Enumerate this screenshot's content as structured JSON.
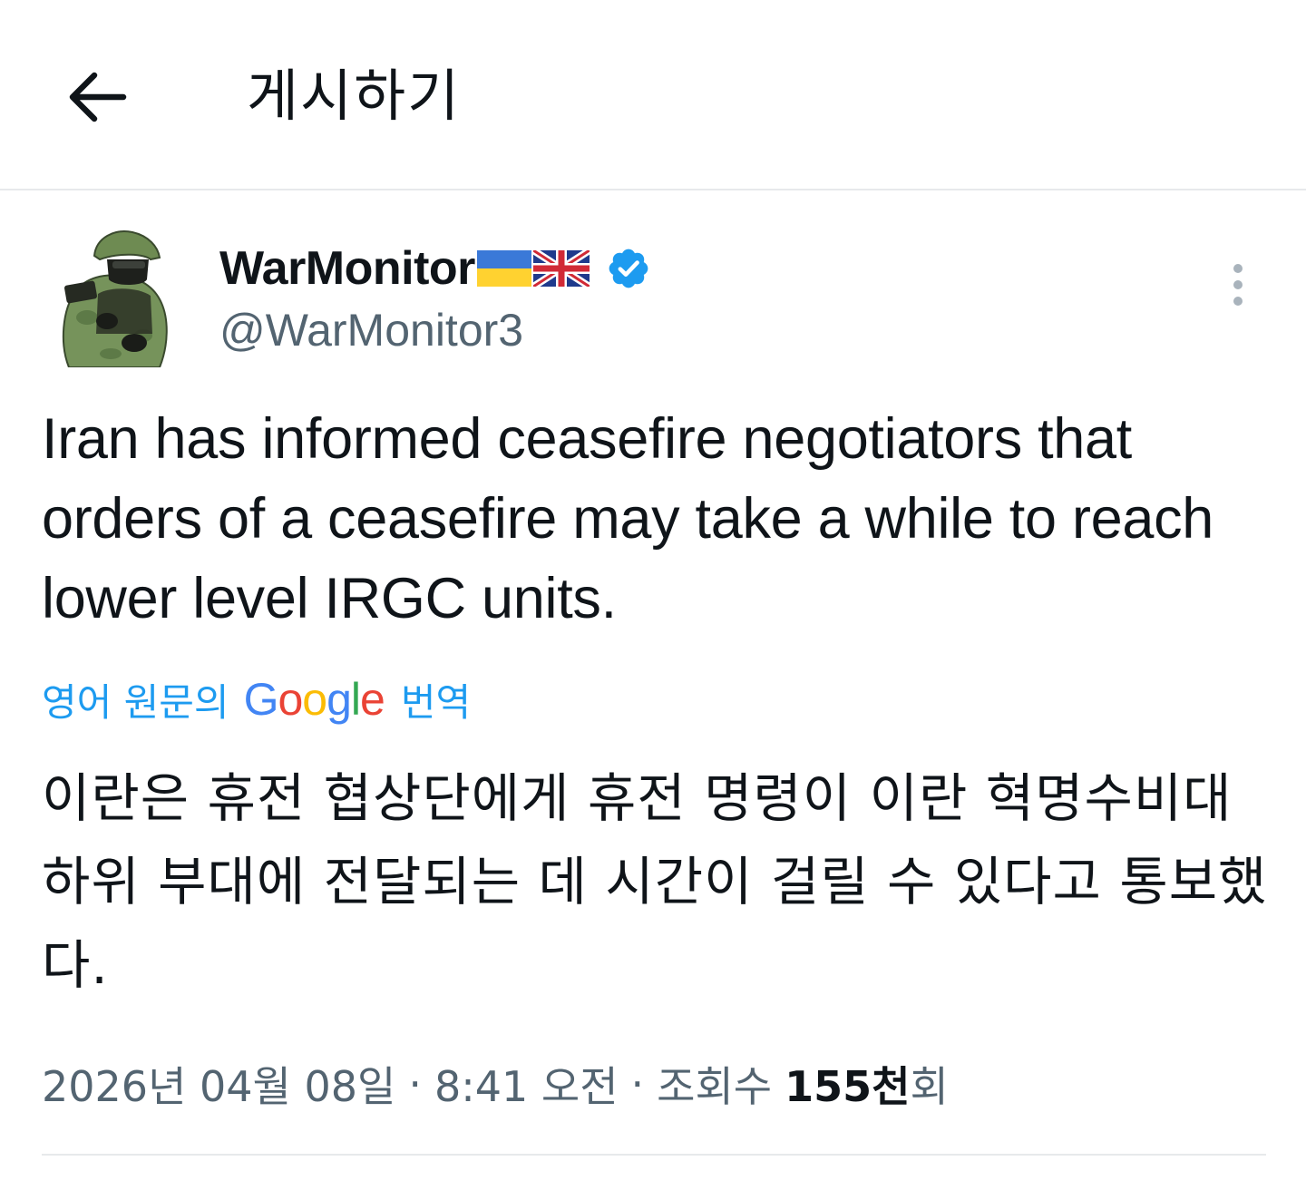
{
  "header": {
    "title": "게시하기",
    "back_icon": "arrow-left-icon"
  },
  "author": {
    "display_name": "WarMonitor",
    "flags": [
      "ukraine-flag-icon",
      "uk-flag-icon"
    ],
    "verified_icon": "verified-badge-icon",
    "handle": "@WarMonitor3",
    "avatar_icon": "soldier-avatar-icon"
  },
  "more_icon": "more-vertical-icon",
  "tweet": {
    "text": "Iran has informed ceasefire negotiators that orders of a ceasefire may take a while to reach lower level IRGC units.",
    "translation_prefix": "영어 원문의",
    "translation_brand": "Google",
    "translation_suffix": "번역",
    "translated_text": "이란은 휴전 협상단에게 휴전 명령이 이란 혁명수비대 하위 부대에 전달되는 데 시간이 걸릴 수 있다고 통보했다."
  },
  "meta": {
    "date": "2026년 04월 08일",
    "separator": "·",
    "time": "8:41 오전",
    "views_label_prefix": "조회수",
    "views_count": "155천",
    "views_label_suffix": "회"
  },
  "colors": {
    "text": "#0f1419",
    "secondary": "#536471",
    "link": "#1d9bf0",
    "verified": "#1d9bf0",
    "divider": "#e7e9eb"
  }
}
